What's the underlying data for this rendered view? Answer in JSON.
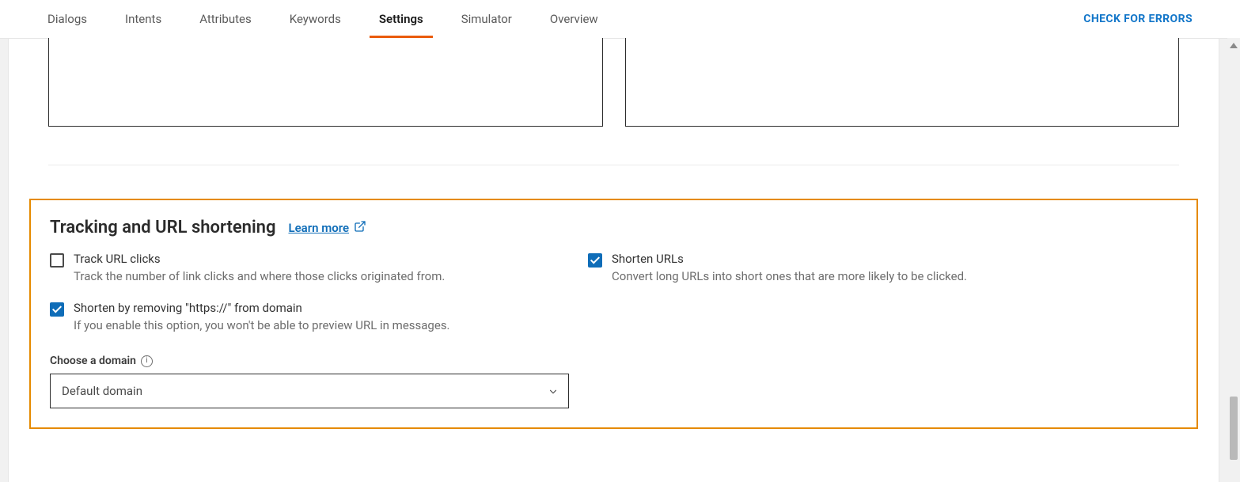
{
  "tabs": {
    "items": [
      {
        "label": "Dialogs"
      },
      {
        "label": "Intents"
      },
      {
        "label": "Attributes"
      },
      {
        "label": "Keywords"
      },
      {
        "label": "Settings"
      },
      {
        "label": "Simulator"
      },
      {
        "label": "Overview"
      }
    ],
    "active_index": 4
  },
  "actions": {
    "check_errors": "CHECK FOR ERRORS"
  },
  "tracking_section": {
    "title": "Tracking and URL shortening",
    "learn_more": "Learn more",
    "track_clicks": {
      "checked": false,
      "label": "Track URL clicks",
      "desc": "Track the number of link clicks and where those clicks originated from."
    },
    "shorten_urls": {
      "checked": true,
      "label": "Shorten URLs",
      "desc": "Convert long URLs into short ones that are more likely to be clicked."
    },
    "shorten_remove_https": {
      "checked": true,
      "label": "Shorten by removing \"https://\" from domain",
      "desc": "If you enable this option, you won't be able to preview URL in messages."
    },
    "domain_field": {
      "label": "Choose a domain",
      "selected": "Default domain"
    }
  },
  "colors": {
    "accent": "#ea5b0c",
    "highlight_border": "#e58a00",
    "link": "#0f6db8"
  }
}
